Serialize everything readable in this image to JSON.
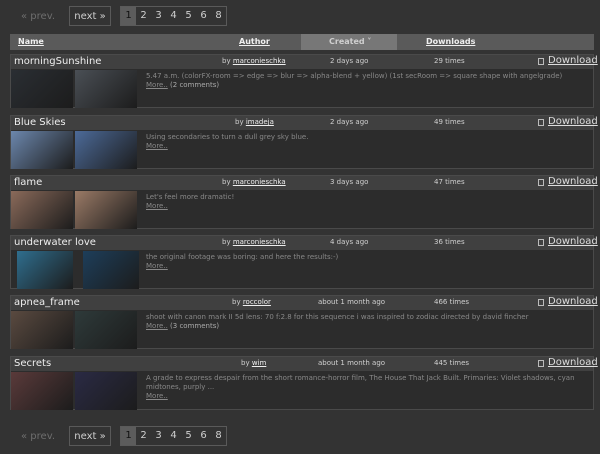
{
  "pager": {
    "prev": "« prev.",
    "next": "next »",
    "pages": [
      "1",
      "2",
      "3",
      "4",
      "5",
      "6",
      "8"
    ]
  },
  "header": {
    "name": "Name",
    "author": "Author",
    "created": "Created ˅",
    "downloads": "Downloads"
  },
  "rows": [
    {
      "title": "morningSunshine",
      "by": "by",
      "author": "marconieschka",
      "date": "2 days ago",
      "times": "29 times",
      "download": "Download",
      "desc": "5.47 a.m. (colorFX-room => edge => blur => alpha-blend + yellow) (1st secRoom => square shape with angelgrade)",
      "more": "More..",
      "comments": "(2 comments)"
    },
    {
      "title": "Blue Skies",
      "by": "by",
      "author": "imadeja",
      "date": "2 days ago",
      "times": "49 times",
      "download": "Download",
      "desc": "Using secondaries to turn a dull grey sky blue.",
      "more": "More..",
      "comments": ""
    },
    {
      "title": "flame",
      "by": "by",
      "author": "marconieschka",
      "date": "3 days ago",
      "times": "47 times",
      "download": "Download",
      "desc": "Let's feel more dramatic!",
      "more": "More..",
      "comments": ""
    },
    {
      "title": "underwater love",
      "by": "by",
      "author": "marconieschka",
      "date": "4 days ago",
      "times": "36 times",
      "download": "Download",
      "desc": "the original footage was boring: and here the results:-)",
      "more": "More..",
      "comments": ""
    },
    {
      "title": "apnea_frame",
      "by": "by",
      "author": "roccolor",
      "date": "about 1 month ago",
      "times": "466 times",
      "download": "Download",
      "desc": "shoot with canon mark II 5d lens: 70 f:2.8 for this sequence i was inspired to zodiac directed by david fincher",
      "more": "More..",
      "comments": "(3 comments)"
    },
    {
      "title": "Secrets",
      "by": "by",
      "author": "wim",
      "date": "about 1 month ago",
      "times": "445 times",
      "download": "Download",
      "desc": "A grade to express despair from the short romance-horror film, The House That Jack Built. Primaries: Violet shadows, cyan midtones, purply ...",
      "more": "More..",
      "comments": ""
    }
  ],
  "thumb_colors": [
    [
      "#2a2e33",
      "#4a4f55"
    ],
    [
      "#6c87ad",
      "#4c6a98"
    ],
    [
      "#8a6a5a",
      "#9a7a66"
    ],
    [
      "#2f6e8e",
      "#1d3e5a"
    ],
    [
      "#5a4a40",
      "#2e3a3a"
    ],
    [
      "#5a3a3a",
      "#2a2a44"
    ]
  ]
}
